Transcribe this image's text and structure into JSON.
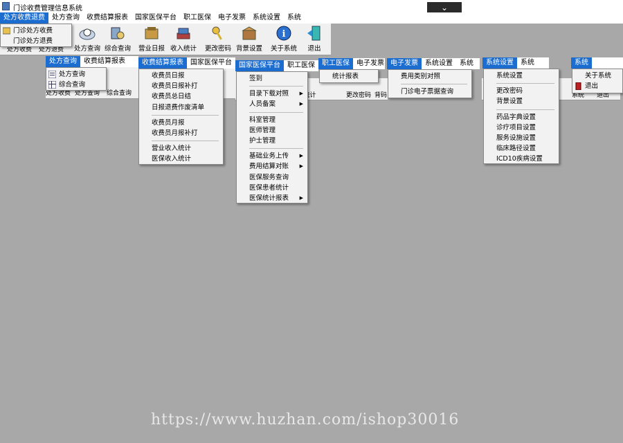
{
  "window": {
    "title": "门诊收费管理信息系统",
    "control_glyph": "⌄"
  },
  "main_menu": [
    "处方收费退费",
    "处方查询",
    "收费结算报表",
    "国家医保平台",
    "职工医保",
    "电子发票",
    "系统设置",
    "系统"
  ],
  "main_toolbar": [
    "处方查询",
    "综合查询",
    "营业日报",
    "收入统计",
    "更改密码",
    "背景设置",
    "关于系统",
    "退出"
  ],
  "submenu_prescription_fee": [
    "门诊处方收费",
    "门诊处方退费"
  ],
  "bar2_menu": [
    "处方查询",
    "收费结算报表"
  ],
  "submenu_query": [
    "处方查询",
    "综合查询"
  ],
  "bar3_menu": [
    "收费结算报表",
    "国家医保平台"
  ],
  "submenu_report": [
    "收费员日报",
    "收费员日报补打",
    "收费员总日结",
    "日报退费作废清单",
    "收费员月报",
    "收费员月报补打",
    "营业收入统计",
    "医保收入统计"
  ],
  "bar4_menu": [
    "国家医保平台",
    "职工医保"
  ],
  "submenu_national_insurance": [
    "签到",
    "目录下载对照",
    "人员备案",
    "科室管理",
    "医师管理",
    "护士管理",
    "基础业务上传",
    "费用结算对账",
    "医保服务查询",
    "医保患者统计",
    "医保统计报表"
  ],
  "bar5_menu": [
    "职工医保",
    "电子发票"
  ],
  "submenu_worker_insurance": [
    "统计报表"
  ],
  "bar6_menu": [
    "电子发票",
    "系统设置",
    "系统"
  ],
  "submenu_einvoice": [
    "费用类别对照",
    "门诊电子票据查询"
  ],
  "bar7_menu": [
    "系统设置",
    "系统"
  ],
  "submenu_settings": [
    "系统设置",
    "更改密码",
    "背景设置",
    "药品字典设置",
    "诊疗项目设置",
    "服务设施设置",
    "临床路径设置",
    "ICD10疾病设置"
  ],
  "bar8_menu": [
    "系统"
  ],
  "submenu_system": [
    "关于系统",
    "退出"
  ],
  "bg_toolbar_fragments": [
    "处方收费",
    "处方退费",
    "处方收费",
    "处方查询",
    "综合查询",
    "收",
    "入统计",
    "更改密码",
    "背码",
    "系统",
    "退出"
  ],
  "watermark": "https://www.huzhan.com/ishop30016",
  "colors": {
    "menu_highlight": "#1c6dd0",
    "background": "#a8a8a8"
  }
}
